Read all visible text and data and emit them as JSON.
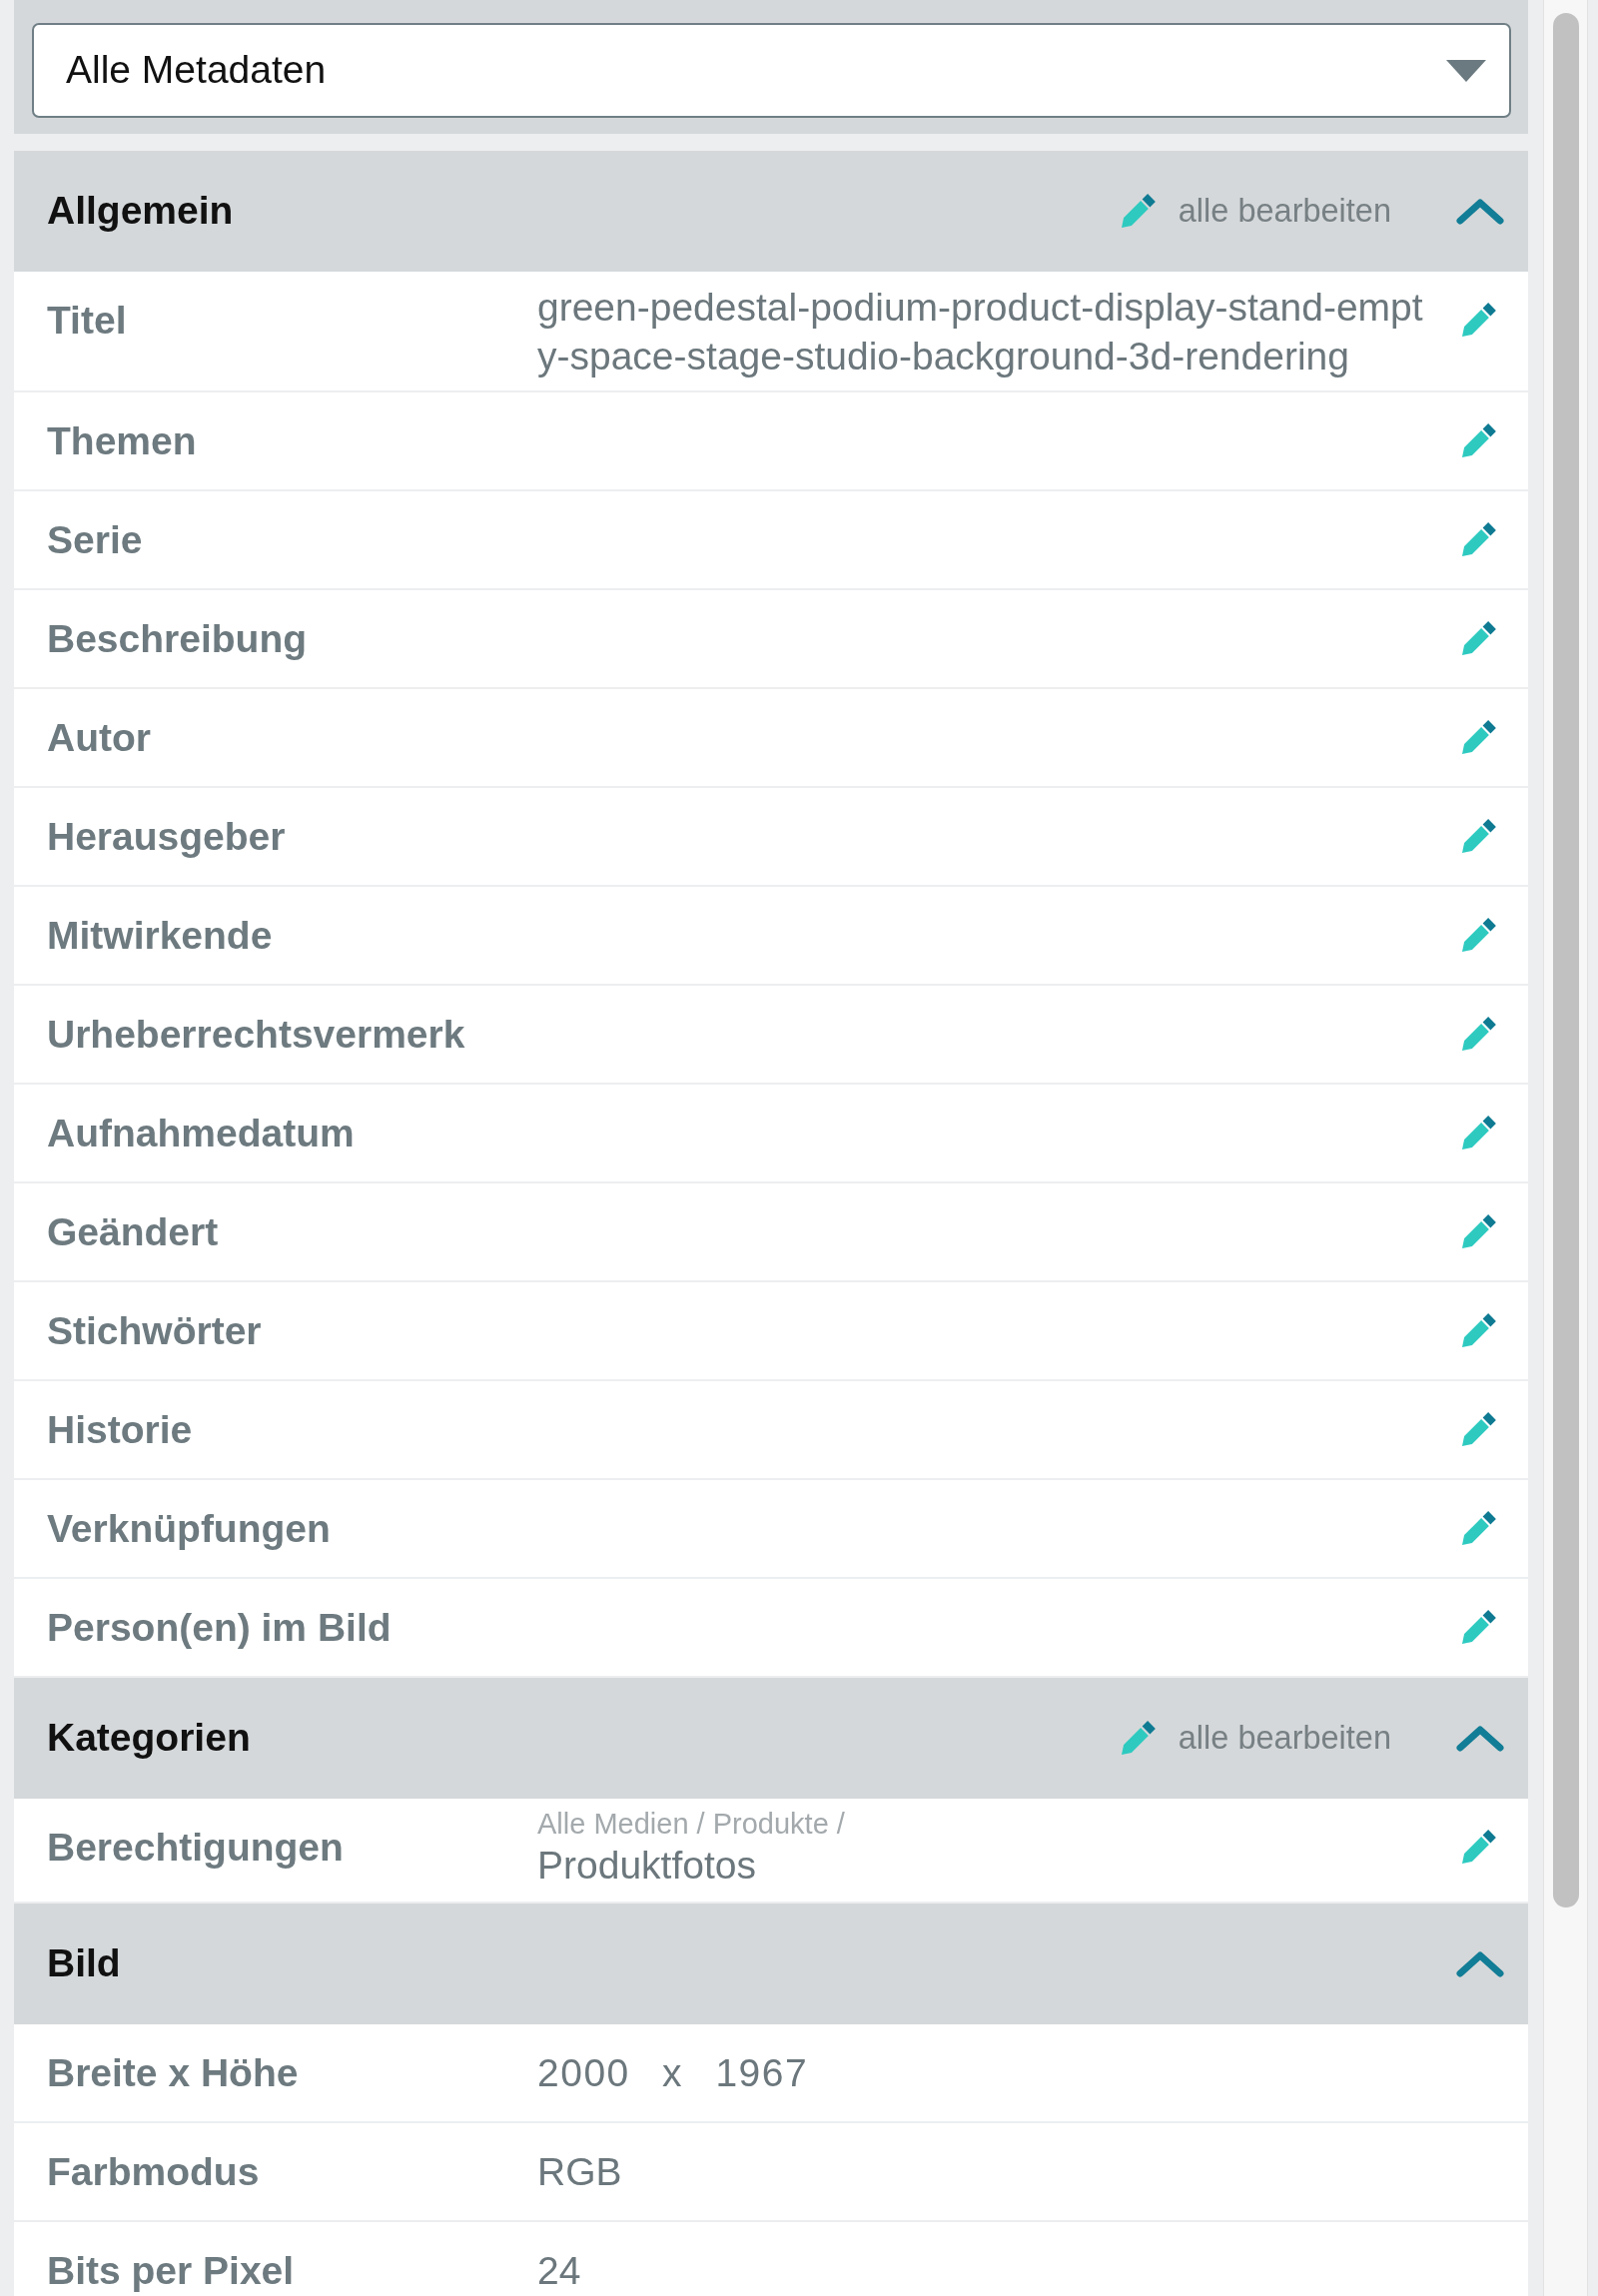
{
  "filter": {
    "value": "Alle Metadaten"
  },
  "sections": [
    {
      "title": "Allgemein",
      "expanded": true,
      "edit_all": "alle bearbeiten",
      "fields": [
        {
          "kind": "text",
          "label": "Titel",
          "value": "green-pedestal-podium-product-display-stand-empty-space-stage-studio-background-3d-rendering",
          "editable": true
        },
        {
          "kind": "text",
          "label": "Themen",
          "editable": true
        },
        {
          "kind": "text",
          "label": "Serie",
          "editable": true
        },
        {
          "kind": "text",
          "label": "Beschreibung",
          "editable": true
        },
        {
          "kind": "text",
          "label": "Autor",
          "editable": true
        },
        {
          "kind": "text",
          "label": "Herausgeber",
          "editable": true
        },
        {
          "kind": "text",
          "label": "Mitwirkende",
          "editable": true
        },
        {
          "kind": "text",
          "label": "Urheberrechtsvermerk",
          "editable": true
        },
        {
          "kind": "text",
          "label": "Aufnahmedatum",
          "editable": true
        },
        {
          "kind": "text",
          "label": "Geändert",
          "editable": true
        },
        {
          "kind": "text",
          "label": "Stichwörter",
          "editable": true
        },
        {
          "kind": "text",
          "label": "Historie",
          "editable": true
        },
        {
          "kind": "text",
          "label": "Verknüpfungen",
          "editable": true
        },
        {
          "kind": "text",
          "label": "Person(en) im Bild",
          "editable": true
        }
      ]
    },
    {
      "title": "Kategorien",
      "expanded": true,
      "edit_all": "alle bearbeiten",
      "fields": [
        {
          "kind": "category",
          "label": "Berechtigungen",
          "path": "Alle Medien / Produkte /",
          "value": "Produktfotos",
          "editable": true
        }
      ]
    },
    {
      "title": "Bild",
      "expanded": true,
      "fields": [
        {
          "kind": "dimensions",
          "label": "Breite x Höhe",
          "value": "2000 x 1967",
          "editable": false
        },
        {
          "kind": "text",
          "label": "Farbmodus",
          "value": "RGB",
          "editable": false
        },
        {
          "kind": "text",
          "label": "Bits per Pixel",
          "value": "24",
          "editable": false
        }
      ]
    }
  ]
}
